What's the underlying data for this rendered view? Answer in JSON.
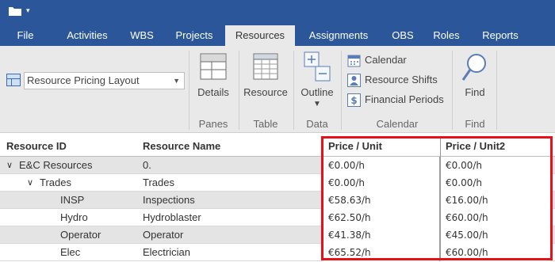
{
  "ribbon_tabs": [
    "File",
    "Activities",
    "WBS",
    "Projects",
    "Resources",
    "Assignments",
    "OBS",
    "Roles",
    "Reports"
  ],
  "active_tab": "Resources",
  "layout": {
    "selected": "Resource Pricing Layout"
  },
  "buttons": {
    "details": "Details",
    "resource": "Resource",
    "outline": "Outline",
    "calendar": "Calendar",
    "resource_shifts": "Resource Shifts",
    "financial_periods": "Financial Periods",
    "find": "Find"
  },
  "groups": {
    "panes": "Panes",
    "table": "Table",
    "data": "Data",
    "calendar": "Calendar",
    "find": "Find"
  },
  "grid": {
    "columns": [
      "Resource ID",
      "Resource Name",
      "Price / Unit",
      "Price / Unit2"
    ],
    "rows": [
      {
        "id": "E&C Resources",
        "name": "0.",
        "price1": "€0.00/h",
        "price2": "€0.00/h",
        "expander": "∨"
      },
      {
        "id": "Trades",
        "name": "Trades",
        "price1": "€0.00/h",
        "price2": "€0.00/h",
        "expander": "∨"
      },
      {
        "id": "INSP",
        "name": "Inspections",
        "price1": "€58.63/h",
        "price2": "€16.00/h"
      },
      {
        "id": "Hydro",
        "name": "Hydroblaster",
        "price1": "€62.50/h",
        "price2": "€60.00/h"
      },
      {
        "id": "Operator",
        "name": "Operator",
        "price1": "€41.38/h",
        "price2": "€45.00/h"
      },
      {
        "id": "Elec",
        "name": "Electrician",
        "price1": "€65.52/h",
        "price2": "€60.00/h"
      }
    ]
  },
  "colors": {
    "accent": "#2b579a",
    "highlight": "#e8111b"
  }
}
